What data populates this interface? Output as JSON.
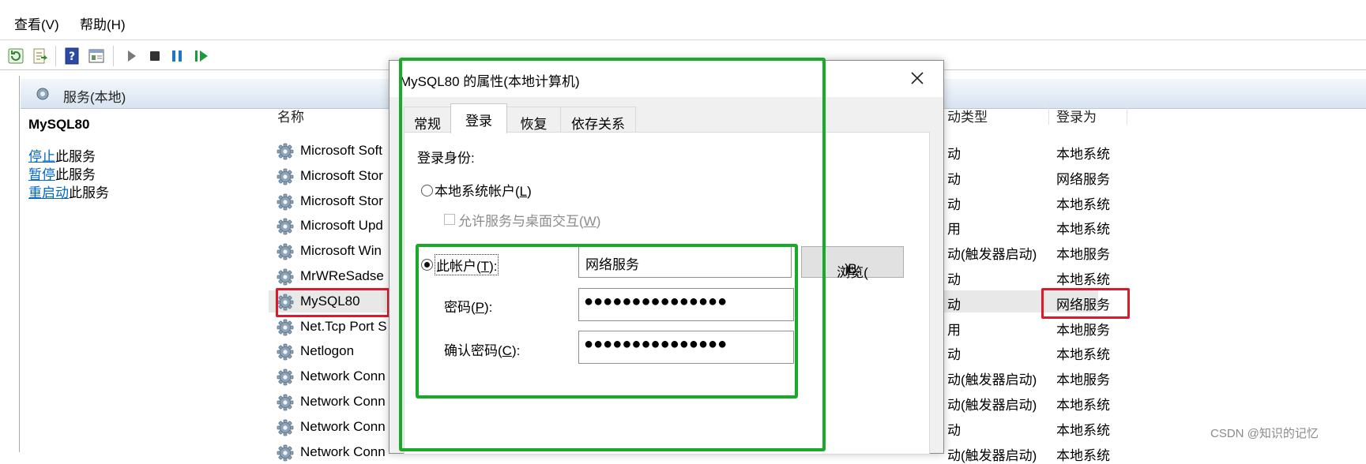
{
  "menu": {
    "view": "查看(V)",
    "help": "帮助(H)"
  },
  "header": {
    "title": "服务(本地)"
  },
  "desc": {
    "service_name": "MySQL80",
    "stop_link": "停止",
    "stop_rest": "此服务",
    "pause_link": "暂停",
    "pause_rest": "此服务",
    "restart_link": "重启动",
    "restart_rest": "此服务"
  },
  "columns": {
    "name": "名称",
    "startup": "动类型",
    "logon": "登录为"
  },
  "rows": [
    {
      "name": "Microsoft Soft",
      "startup": "动",
      "logon": "本地系统"
    },
    {
      "name": "Microsoft Stor",
      "startup": "动",
      "logon": "网络服务"
    },
    {
      "name": "Microsoft Stor",
      "startup": "动",
      "logon": "本地系统"
    },
    {
      "name": "Microsoft Upd",
      "startup": "用",
      "logon": "本地系统"
    },
    {
      "name": "Microsoft Win",
      "startup": "动(触发器启动)",
      "logon": "本地服务"
    },
    {
      "name": "MrWReSadse",
      "startup": "动",
      "logon": "本地系统"
    },
    {
      "name": "MySQL80",
      "startup": "动",
      "logon": "网络服务"
    },
    {
      "name": "Net.Tcp Port S",
      "startup": "用",
      "logon": "本地服务"
    },
    {
      "name": "Netlogon",
      "startup": "动",
      "logon": "本地系统"
    },
    {
      "name": "Network Conn",
      "startup": "动(触发器启动)",
      "logon": "本地服务"
    },
    {
      "name": "Network Conn",
      "startup": "动(触发器启动)",
      "logon": "本地系统"
    },
    {
      "name": "Network Conn",
      "startup": "动",
      "logon": "本地系统"
    },
    {
      "name": "Network Conn",
      "startup": "动(触发器启动)",
      "logon": "本地系统"
    }
  ],
  "dialog": {
    "title": "MySQL80 的属性(本地计算机)",
    "tabs": [
      "常规",
      "登录",
      "恢复",
      "依存关系"
    ],
    "active_tab": "登录",
    "logon_as": "登录身份:",
    "local_system": {
      "pre": "本地系统帐户(",
      "key": "L",
      "post": ")"
    },
    "interact": {
      "pre": "允许服务与桌面交互(",
      "key": "W",
      "post": ")"
    },
    "this_account": {
      "pre": "此帐户(",
      "key": "T",
      "post": "):"
    },
    "account_value": "网络服务",
    "browse": {
      "pre": "浏览(",
      "key": "B",
      "post": ")..."
    },
    "password": {
      "pre": "密码(",
      "key": "P",
      "post": "):"
    },
    "password_value": "●●●●●●●●●●●●●●●",
    "confirm": {
      "pre": "确认密码(",
      "key": "C",
      "post": "):"
    },
    "confirm_value": "●●●●●●●●●●●●●●●"
  },
  "watermark": "CSDN @知识的记忆",
  "colors": {
    "highlight_red": "#e0192a",
    "highlight_green": "#1aaa2a",
    "link": "#0066cc"
  }
}
